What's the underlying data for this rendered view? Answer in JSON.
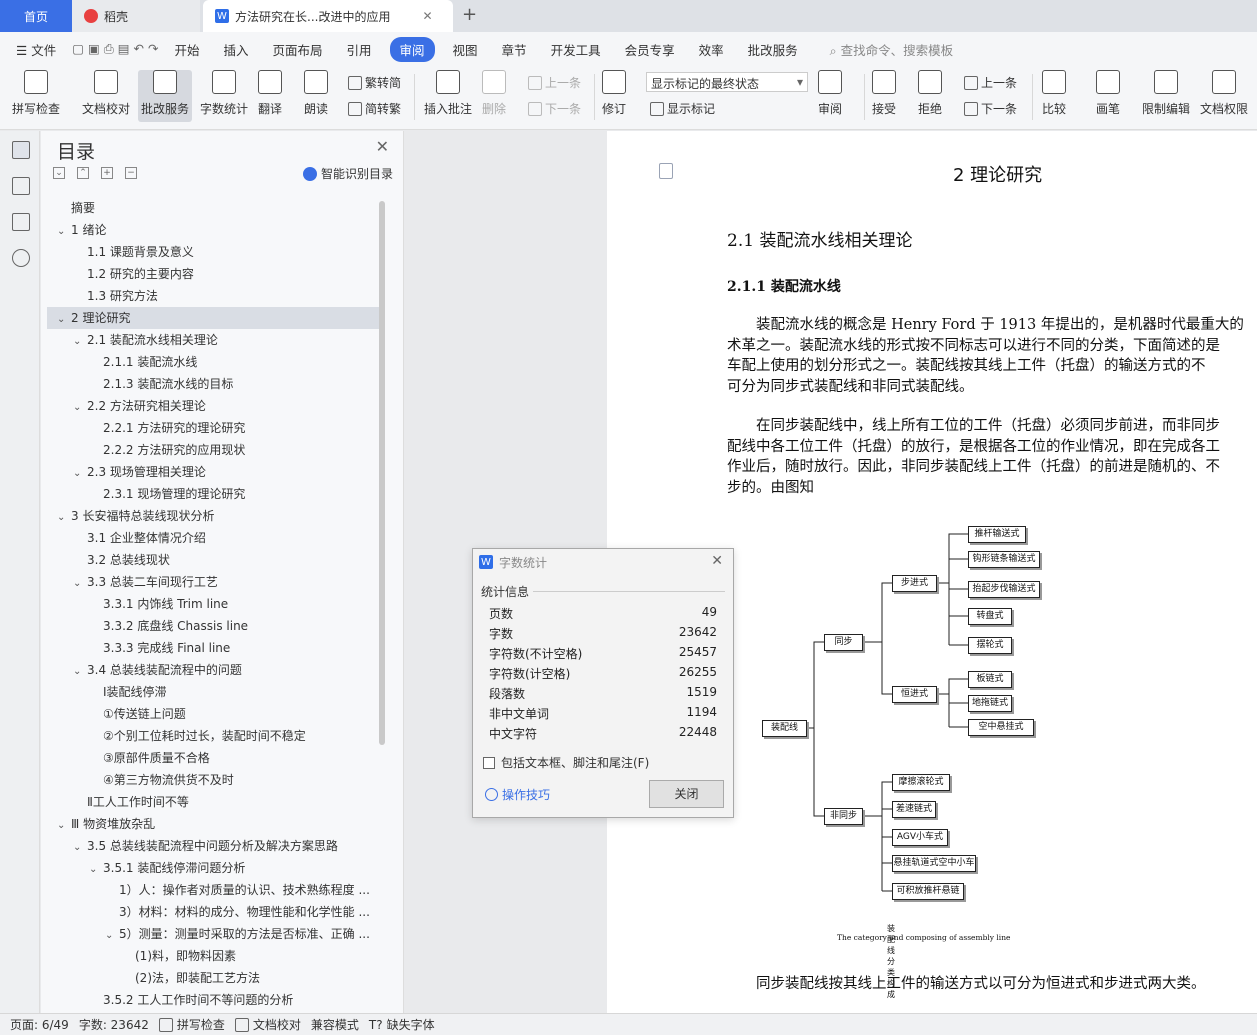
{
  "tabs": {
    "home": "首页",
    "daoke": "稻壳",
    "doc": "方法研究在长...改进中的应用"
  },
  "menu": {
    "file": "文件",
    "items": [
      "开始",
      "插入",
      "页面布局",
      "引用",
      "审阅",
      "视图",
      "章节",
      "开发工具",
      "会员专享",
      "效率",
      "批改服务"
    ],
    "active": "审阅",
    "search": "查找命令、搜索模板"
  },
  "ribbon": {
    "spell": "拼写检查",
    "proof": "文档校对",
    "correct": "批改服务",
    "wordcount": "字数统计",
    "translate": "翻译",
    "read": "朗读",
    "trad": "繁转简",
    "simp": "简转繁",
    "insert_comment": "插入批注",
    "delete": "删除",
    "prev1": "上一条",
    "next1": "下一条",
    "revise": "修订",
    "show_final": "显示标记的最终状态",
    "show_marks": "显示标记",
    "review": "审阅",
    "accept": "接受",
    "reject": "拒绝",
    "prev2": "上一条",
    "next2": "下一条",
    "compare": "比较",
    "pen": "画笔",
    "restrict": "限制编辑",
    "perm": "文档权限"
  },
  "nav": {
    "title": "目录",
    "smart": "智能识别目录",
    "items": [
      {
        "t": "摘要",
        "lvl": 0,
        "tg": ""
      },
      {
        "t": "1  绪论",
        "lvl": 0,
        "tg": "v"
      },
      {
        "t": "1.1 课题背景及意义",
        "lvl": 1,
        "tg": ""
      },
      {
        "t": "1.2 研究的主要内容",
        "lvl": 1,
        "tg": ""
      },
      {
        "t": "1.3 研究方法",
        "lvl": 1,
        "tg": ""
      },
      {
        "t": "2  理论研究",
        "lvl": 0,
        "tg": "v",
        "sel": true
      },
      {
        "t": "2.1 装配流水线相关理论",
        "lvl": 1,
        "tg": "v"
      },
      {
        "t": "2.1.1 装配流水线",
        "lvl": 2,
        "tg": ""
      },
      {
        "t": "2.1.3 装配流水线的目标",
        "lvl": 2,
        "tg": ""
      },
      {
        "t": "2.2 方法研究相关理论",
        "lvl": 1,
        "tg": "v"
      },
      {
        "t": "2.2.1 方法研究的理论研究",
        "lvl": 2,
        "tg": ""
      },
      {
        "t": "2.2.2 方法研究的应用现状",
        "lvl": 2,
        "tg": ""
      },
      {
        "t": "2.3 现场管理相关理论",
        "lvl": 1,
        "tg": "v"
      },
      {
        "t": "2.3.1 现场管理的理论研究",
        "lvl": 2,
        "tg": ""
      },
      {
        "t": "3  长安福特总装线现状分析",
        "lvl": 0,
        "tg": "v"
      },
      {
        "t": "3.1 企业整体情况介绍",
        "lvl": 1,
        "tg": ""
      },
      {
        "t": "3.2 总装线现状",
        "lvl": 1,
        "tg": ""
      },
      {
        "t": "3.3 总装二车间现行工艺",
        "lvl": 1,
        "tg": "v"
      },
      {
        "t": "3.3.1 内饰线  Trim line",
        "lvl": 2,
        "tg": ""
      },
      {
        "t": "3.3.2 底盘线  Chassis line",
        "lvl": 2,
        "tg": ""
      },
      {
        "t": "3.3.3 完成线  Final line",
        "lvl": 2,
        "tg": ""
      },
      {
        "t": "3.4 总装线装配流程中的问题",
        "lvl": 1,
        "tg": "v"
      },
      {
        "t": "Ⅰ装配线停滞",
        "lvl": 2,
        "tg": ""
      },
      {
        "t": "①传送链上问题",
        "lvl": 2,
        "tg": ""
      },
      {
        "t": "②个别工位耗时过长，装配时间不稳定",
        "lvl": 2,
        "tg": ""
      },
      {
        "t": "③原部件质量不合格",
        "lvl": 2,
        "tg": ""
      },
      {
        "t": "④第三方物流供货不及时",
        "lvl": 2,
        "tg": ""
      },
      {
        "t": "Ⅱ工人工作时间不等",
        "lvl": 1,
        "tg": ""
      },
      {
        "t": "Ⅲ 物资堆放杂乱",
        "lvl": 0,
        "tg": "v"
      },
      {
        "t": "3.5 总装线装配流程中问题分析及解决方案思路",
        "lvl": 1,
        "tg": "v"
      },
      {
        "t": "3.5.1 装配线停滞问题分析",
        "lvl": 2,
        "tg": "v"
      },
      {
        "t": "1）人：操作者对质量的认识、技术熟练程度 ...",
        "lvl": 3,
        "tg": ""
      },
      {
        "t": "3）材料：材料的成分、物理性能和化学性能 ...",
        "lvl": 3,
        "tg": ""
      },
      {
        "t": "5）测量：测量时采取的方法是否标准、正确 ...",
        "lvl": 3,
        "tg": "v"
      },
      {
        "t": "(1)料，即物料因素",
        "lvl": 4,
        "tg": ""
      },
      {
        "t": "(2)法，即装配工艺方法",
        "lvl": 4,
        "tg": ""
      },
      {
        "t": "3.5.2 工人工作时间不等问题的分析",
        "lvl": 2,
        "tg": ""
      }
    ]
  },
  "doc": {
    "chapter": "2  理论研究",
    "sec21": "2.1 装配流水线相关理论",
    "sec211": "2.1.1 装配流水线",
    "p1": [
      "　　装配流水线的概念是 Henry Ford 于 1913 年提出的，是机器时代最重大的",
      "术革之一。装配流水线的形式按不同标志可以进行不同的分类，下面简述的是",
      "车配上使用的划分形式之一。装配线按其线上工件（托盘）的输送方式的不",
      "可分为同步式装配线和非同式装配线。"
    ],
    "p2": [
      "　　在同步装配线中，线上所有工位的工件（托盘）必须同步前进，而非同步",
      "配线中各工位工件（托盘）的放行，是根据各工位的作业情况，即在完成各工",
      "作业后，随时放行。因此，非同步装配线上工件（托盘）的前进是随机的、不",
      "步的。由图知"
    ],
    "p3": "　　同步装配线按其线上工件的输送方式以可分为恒进式和步进式两大类。",
    "diagram": {
      "root": "装配线",
      "sync": "同步",
      "async": "非同步",
      "step": "步进式",
      "const": "恒进式",
      "step_items": [
        "推杆输送式",
        "钩形链条输送式",
        "抬起步伐输送式",
        "转盘式",
        "摆轮式"
      ],
      "const_items": [
        "板链式",
        "地拖链式",
        "空中悬挂式"
      ],
      "async_items": [
        "摩擦滚轮式",
        "差速链式",
        "AGV小车式",
        "悬挂轨道式空中小车",
        "可积放推杆悬链"
      ],
      "caption1": "装配线分类构成",
      "caption2": "The category and composing of assembly line"
    }
  },
  "dialog": {
    "title": "字数统计",
    "section": "统计信息",
    "rows": [
      {
        "k": "页数",
        "v": "49"
      },
      {
        "k": "字数",
        "v": "23642"
      },
      {
        "k": "字符数(不计空格)",
        "v": "25457"
      },
      {
        "k": "字符数(计空格)",
        "v": "26255"
      },
      {
        "k": "段落数",
        "v": "1519"
      },
      {
        "k": "非中文单词",
        "v": "1194"
      },
      {
        "k": "中文字符",
        "v": "22448"
      }
    ],
    "include": "包括文本框、脚注和尾注(F)",
    "tips": "操作技巧",
    "close": "关闭"
  },
  "status": {
    "page": "页面: 6/49",
    "words": "字数: 23642",
    "spell": "拼写检查",
    "proof": "文档校对",
    "compat": "兼容模式",
    "font": "缺失字体"
  }
}
